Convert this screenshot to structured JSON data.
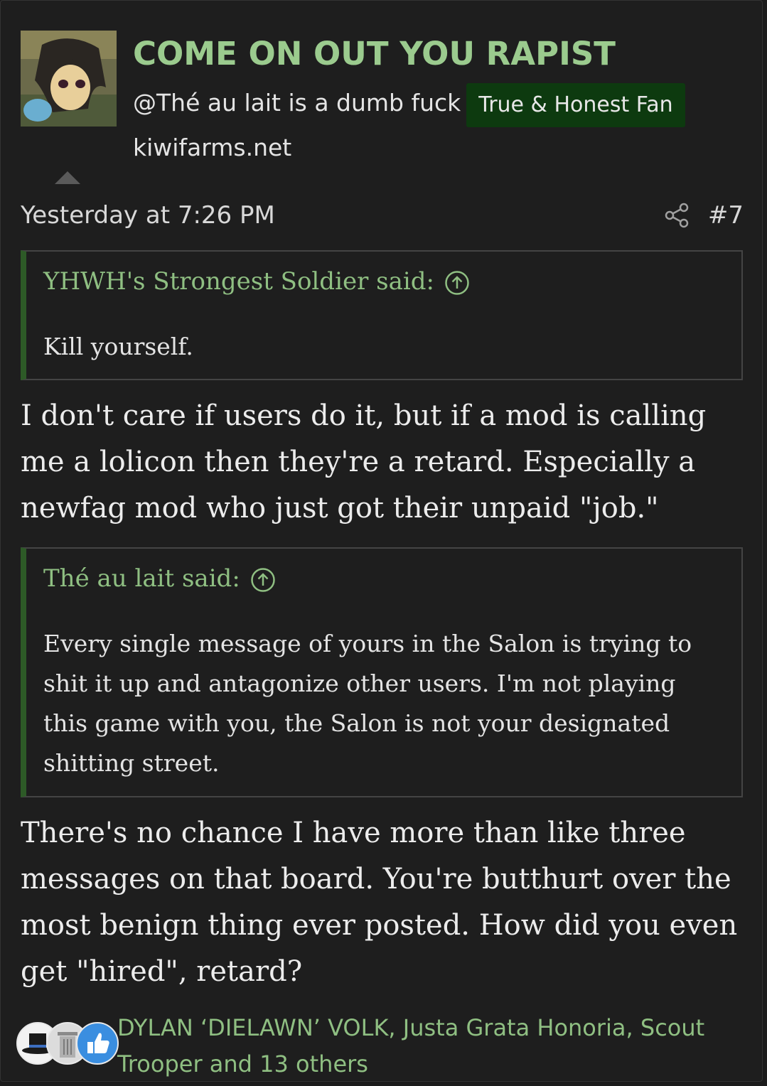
{
  "user": {
    "name": "COME ON OUT YOU RAPIST",
    "title": "@Thé au lait is a dumb fuck",
    "badge": "True & Honest Fan",
    "website": "kiwifarms.net"
  },
  "post": {
    "timestamp": "Yesterday at 7:26 PM",
    "number": "#7",
    "icons": [
      "share-icon",
      "collapse-arrow-icon"
    ],
    "quotes": [
      {
        "author_line": "YHWH's Strongest Soldier said:",
        "text": "Kill yourself."
      },
      {
        "author_line": "Thé au lait said:",
        "text": "Every single message of yours in the Salon is trying to shit it up and antagonize other users. I'm not playing this game with you, the Salon is not your designated shitting street."
      }
    ],
    "paragraphs": [
      "I don't care if users do it, but if a mod is calling me a lolicon then they're a retard. Especially a newfag mod who just got their unpaid \"job.\"",
      "There's no chance I have more than like three messages on that board. You're butthurt over the most benign thing ever posted. How did you even get \"hired\", retard?"
    ]
  },
  "reactions": {
    "icons": [
      "top-hat-reaction-icon",
      "trash-can-reaction-icon",
      "thumbs-up-reaction-icon"
    ],
    "text": "DYLAN ‘DIELAWN’ VOLK, Justa Grata Honoria, Scout Trooper and 13 others"
  },
  "colors": {
    "background": "#1e1e1e",
    "accent_green": "#9bcb8e",
    "badge_bg": "#0d3a0f",
    "quote_bar": "#2d5a27"
  }
}
